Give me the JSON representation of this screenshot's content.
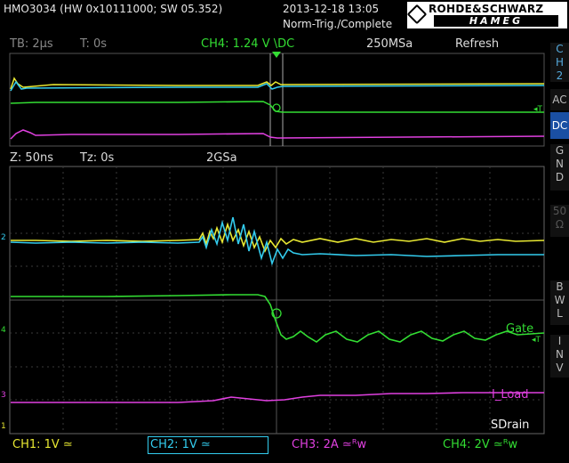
{
  "header": {
    "device": "HMO3034 (HW 0x10111000; SW 05.352)",
    "datetime": "2013-12-18 13:05",
    "trigger_mode": "Norm-Trig./Complete",
    "logo_top": "ROHDE&SCHWARZ",
    "logo_bottom": "HAMEG"
  },
  "overview_bar": {
    "timebase": "TB: 2µs",
    "time_offset": "T: 0s",
    "trigger": "CH4: 1.24 V \\DC",
    "sample_rate": "250MSa",
    "acq_mode": "Refresh"
  },
  "zoom_bar": {
    "zoom": "Z: 50ns",
    "zoom_offset": "Tz: 0s",
    "sample_rate": "2GSa"
  },
  "side_menu": {
    "channel": [
      "C",
      "H",
      "2"
    ],
    "ac": "AC",
    "dc": "DC",
    "gnd": [
      "G",
      "N",
      "D"
    ],
    "fifty": [
      "50",
      "Ω"
    ],
    "bwl": [
      "B",
      "W",
      "L"
    ],
    "inv": [
      "I",
      "N",
      "V"
    ]
  },
  "waveform_labels": {
    "gate": "Gate",
    "i_load": "I_Load",
    "s_drain": "SDrain",
    "trigger_marker": "T"
  },
  "channel_markers": {
    "ch1": "1",
    "ch2": "2",
    "ch3": "3",
    "ch4": "4"
  },
  "footer": {
    "ch1": "CH1: 1V ≃",
    "ch2": "CH2: 1V ≃",
    "ch3": "CH3: 2A ≃ᴿw",
    "ch4": "CH4: 2V ≃ᴿw"
  },
  "colors": {
    "ch1": "#e8e832",
    "ch2": "#33ccee",
    "ch3": "#e040e0",
    "ch4": "#33dd33",
    "selected": "#1a4fa3"
  }
}
